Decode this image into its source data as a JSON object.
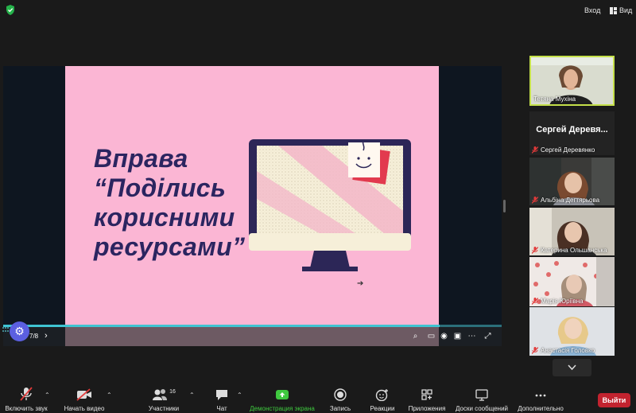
{
  "topbar": {
    "enter_label": "Вход",
    "view_label": "Вид"
  },
  "slide": {
    "title_lines": [
      "Вправа",
      "“Поділись",
      "корисними",
      "ресурсами”"
    ],
    "page_indicator": "7/8",
    "progress": 0.875
  },
  "participants": [
    {
      "name": "Тетяна Мухіна",
      "video": true,
      "active": true,
      "muted": false
    },
    {
      "name": "Сергей Деревянко",
      "display_name": "Сергей Деревя...",
      "video": false,
      "muted": true
    },
    {
      "name": "Альбіна Дегтярьова",
      "video": true,
      "muted": true
    },
    {
      "name": "Катерина Ольшанська",
      "video": true,
      "muted": true
    },
    {
      "name": "Марія Юріївна",
      "video": true,
      "muted": true
    },
    {
      "name": "Анастасія Головко",
      "video": true,
      "muted": true
    }
  ],
  "toolbar": {
    "unmute_label": "Включить звук",
    "video_label": "Начать видео",
    "participants_label": "Участники",
    "participants_count": "16",
    "chat_label": "Чат",
    "share_label": "Демонстрация экрана",
    "record_label": "Запись",
    "reactions_label": "Реакции",
    "apps_label": "Приложения",
    "whiteboards_label": "Доски сообщений",
    "more_label": "Дополнительно",
    "leave_label": "Выйти"
  },
  "colors": {
    "slide_bg": "#fbb6d4",
    "title_color": "#2b2560",
    "share_accent": "#3fc93f",
    "active_speaker": "#c4e04a",
    "leave": "#c2232f"
  }
}
